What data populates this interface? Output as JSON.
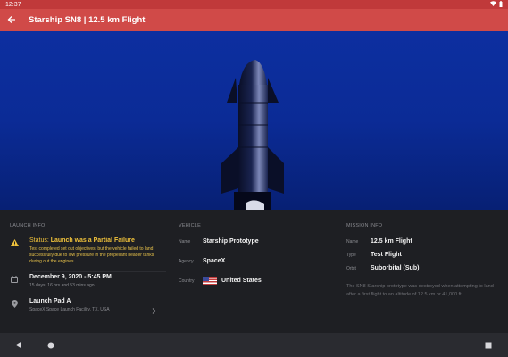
{
  "status_bar": {
    "time": "12:37"
  },
  "app_bar": {
    "title": "Starship SN8 | 12.5 km Flight"
  },
  "launch_info": {
    "title": "LAUNCH INFO",
    "status_label": "Status:",
    "status_value": "Launch was a Partial Failure",
    "status_description": "Test completed set out objectives, but the vehicle failed to land successfully due to low pressure in the propellant header tanks during out the engines.",
    "date": "December 9, 2020 - 5:45 PM",
    "date_relative": "15 days, 16 hrs and 53 mins ago",
    "pad_name": "Launch Pad A",
    "pad_location": "SpaceX Space Launch Facility, TX, USA"
  },
  "vehicle": {
    "title": "VEHICLE",
    "name_label": "Name",
    "name_value": "Starship Prototype",
    "agency_label": "Agency",
    "agency_value": "SpaceX",
    "country_label": "Country",
    "country_value": "United States"
  },
  "mission_info": {
    "title": "MISSION INFO",
    "name_label": "Name",
    "name_value": "12.5 km Flight",
    "type_label": "Type",
    "type_value": "Test Flight",
    "orbit_label": "Orbit",
    "orbit_value": "Suborbital (Sub)",
    "description": "The SN8 Starship prototype was destroyed when attempting to land after a first flight to an altitude of 12.5 km or 41,000 ft."
  },
  "colors": {
    "app_bar": "#d04a48",
    "status_bar": "#c0393a",
    "status_accent": "#f0c23b",
    "panel_background": "#1e1f23",
    "hero_sky": "#0b2b96"
  },
  "icons": {
    "back": "arrow-left-icon",
    "warning": "warning-icon",
    "calendar": "calendar-icon",
    "location": "location-pin-icon",
    "chevron": "chevron-right-icon"
  }
}
